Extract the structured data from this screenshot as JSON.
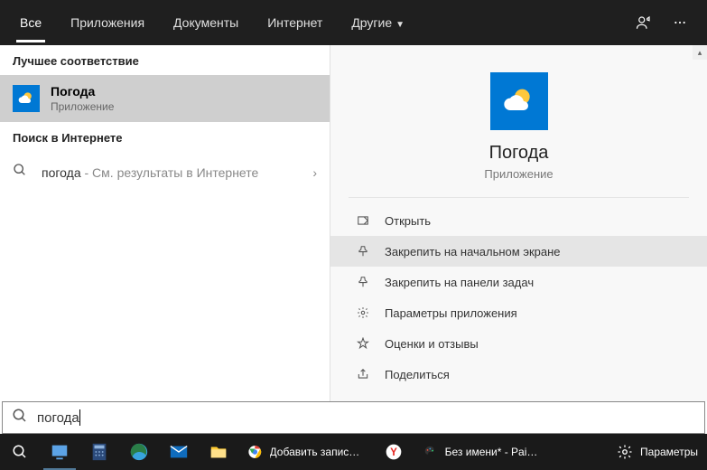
{
  "header": {
    "tabs": [
      {
        "label": "Все",
        "active": true
      },
      {
        "label": "Приложения",
        "active": false
      },
      {
        "label": "Документы",
        "active": false
      },
      {
        "label": "Интернет",
        "active": false
      },
      {
        "label": "Другие",
        "active": false,
        "dropdown": true
      }
    ]
  },
  "left": {
    "best_match_label": "Лучшее соответствие",
    "best_match": {
      "title": "Погода",
      "subtitle": "Приложение"
    },
    "web_label": "Поиск в Интернете",
    "web_result": {
      "term": "погода",
      "hint": " - См. результаты в Интернете"
    }
  },
  "preview": {
    "title": "Погода",
    "subtitle": "Приложение",
    "actions": [
      {
        "icon": "open",
        "label": "Открыть",
        "hover": false
      },
      {
        "icon": "pin-start",
        "label": "Закрепить на начальном экране",
        "hover": true
      },
      {
        "icon": "pin-taskbar",
        "label": "Закрепить на панели задач",
        "hover": false
      },
      {
        "icon": "settings",
        "label": "Параметры приложения",
        "hover": false
      },
      {
        "icon": "star",
        "label": "Оценки и отзывы",
        "hover": false
      },
      {
        "icon": "share",
        "label": "Поделиться",
        "hover": false
      }
    ]
  },
  "search": {
    "value": "погода"
  },
  "taskbar": {
    "apps": [
      {
        "name": "task-view",
        "color": "#5ca3e6"
      },
      {
        "name": "calculator",
        "color": "#3b5998"
      },
      {
        "name": "edge",
        "color": "#38a4dd"
      },
      {
        "name": "mail",
        "color": "#0f6cbd"
      },
      {
        "name": "explorer",
        "color": "#ffcc33"
      }
    ],
    "wide": [
      {
        "icon": "chrome",
        "label": "Добавить запись ‹ ..."
      },
      {
        "icon": "yandex",
        "label": ""
      },
      {
        "icon": "paint",
        "label": "Без имени* - Paint ..."
      }
    ],
    "settings_label": "Параметры"
  }
}
